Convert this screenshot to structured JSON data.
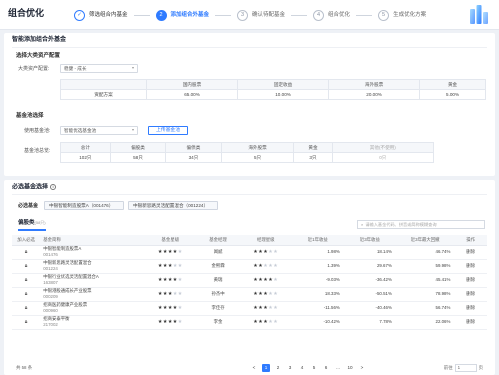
{
  "header": {
    "title": "组合优化",
    "steps": [
      {
        "num": "✓",
        "label": "筛选组合内基金",
        "state": "done"
      },
      {
        "num": "2",
        "label": "添加组合外基金",
        "state": "active"
      },
      {
        "num": "3",
        "label": "确认待配基金",
        "state": "todo"
      },
      {
        "num": "4",
        "label": "组合优化",
        "state": "todo"
      },
      {
        "num": "5",
        "label": "生成优化方案",
        "state": "todo"
      }
    ]
  },
  "smart_add": {
    "title": "智能添加组合外基金",
    "asset_section_title": "选择大类资产配置",
    "asset_label": "大类资产配置:",
    "asset_select": "稳健 - 成长",
    "asset_table": {
      "headers": [
        "",
        "国内股票",
        "固定收益",
        "海外股票",
        "黄金"
      ],
      "row_label": "资配方案",
      "values": [
        "65.00%",
        "10.00%",
        "20.00%",
        "5.00%"
      ]
    },
    "pool_section_title": "基金池选择",
    "pool_label": "使用基金池:",
    "pool_select": "智能优选基金池",
    "upload_button": "上传基金池",
    "count_label": "基金池总览:",
    "count_table": {
      "headers": [
        "总计",
        "偏股类",
        "偏债类",
        "海外股票",
        "黄金",
        "其他(不使用)"
      ],
      "values": [
        "102只",
        "58只",
        "34只",
        "5只",
        "3只",
        "0只"
      ]
    }
  },
  "required": {
    "title": "必选基金选择",
    "label": "必选基金",
    "chips": [
      "中银智能制造股票A（001476）",
      "中银新思路灵活配置混合（001224）"
    ],
    "tab_label": "偏股类",
    "tab_count": "(58只)",
    "search_placeholder": "请输入基金代码、拼音或简称模糊查询",
    "columns": [
      "加入必选",
      "基金简称",
      "基金星级",
      "基金经理",
      "经理星级",
      "近1年收益",
      "近3年收益",
      "近3年最大回撤",
      "操作"
    ],
    "rows": [
      {
        "name": "中银智能制造股票A",
        "code": "001476",
        "fund_stars": 4,
        "manager": "闻斌",
        "mgr_stars": 3,
        "r1": "1.98%",
        "r1c": "red",
        "r3": "18.14%",
        "r3c": "green",
        "dd": "46.74%",
        "op": "删除"
      },
      {
        "name": "中银新思路灵活配置混合",
        "code": "001224",
        "fund_stars": 3,
        "manager": "金熙霖",
        "mgr_stars": 2,
        "r1": "1.39%",
        "r1c": "red",
        "r3": "29.67%",
        "r3c": "green",
        "dd": "59.98%",
        "op": "删除"
      },
      {
        "name": "中银行业优选灵活配置混合A",
        "code": "163807",
        "fund_stars": 4,
        "manager": "黄瑞",
        "mgr_stars": 4,
        "r1": "-9.03%",
        "r1c": "green",
        "r3": "-36.42%",
        "r3c": "green",
        "dd": "45.41%",
        "op": "删除"
      },
      {
        "name": "中银港股通成长产业股票",
        "code": "000209",
        "fund_stars": 3,
        "manager": "孙杰中",
        "mgr_stars": 3,
        "r1": "18.33%",
        "r1c": "red",
        "r3": "-50.51%",
        "r3c": "green",
        "dd": "78.98%",
        "op": "删除"
      },
      {
        "name": "招商医药健康产业股票",
        "code": "000960",
        "fund_stars": 4,
        "manager": "李佳存",
        "mgr_stars": 3,
        "r1": "-11.56%",
        "r1c": "green",
        "r3": "-40.46%",
        "r3c": "green",
        "dd": "56.74%",
        "op": "删除"
      },
      {
        "name": "招商安泰平衡",
        "code": "217002",
        "fund_stars": 4,
        "manager": "李金",
        "mgr_stars": 3,
        "r1": "-10.42%",
        "r1c": "red",
        "r3": "7.78%",
        "r3c": "red",
        "dd": "22.06%",
        "op": "删除"
      }
    ],
    "total_text": "共 58 条",
    "pages": [
      "<",
      "1",
      "2",
      "3",
      "4",
      "5",
      "6",
      "...",
      "10",
      ">"
    ],
    "goto_label": "前往",
    "goto_value": "1",
    "goto_suffix": "页"
  },
  "colors": {
    "accent": "#2f7bff",
    "up": "#e33333",
    "down": "#1a9a47"
  }
}
